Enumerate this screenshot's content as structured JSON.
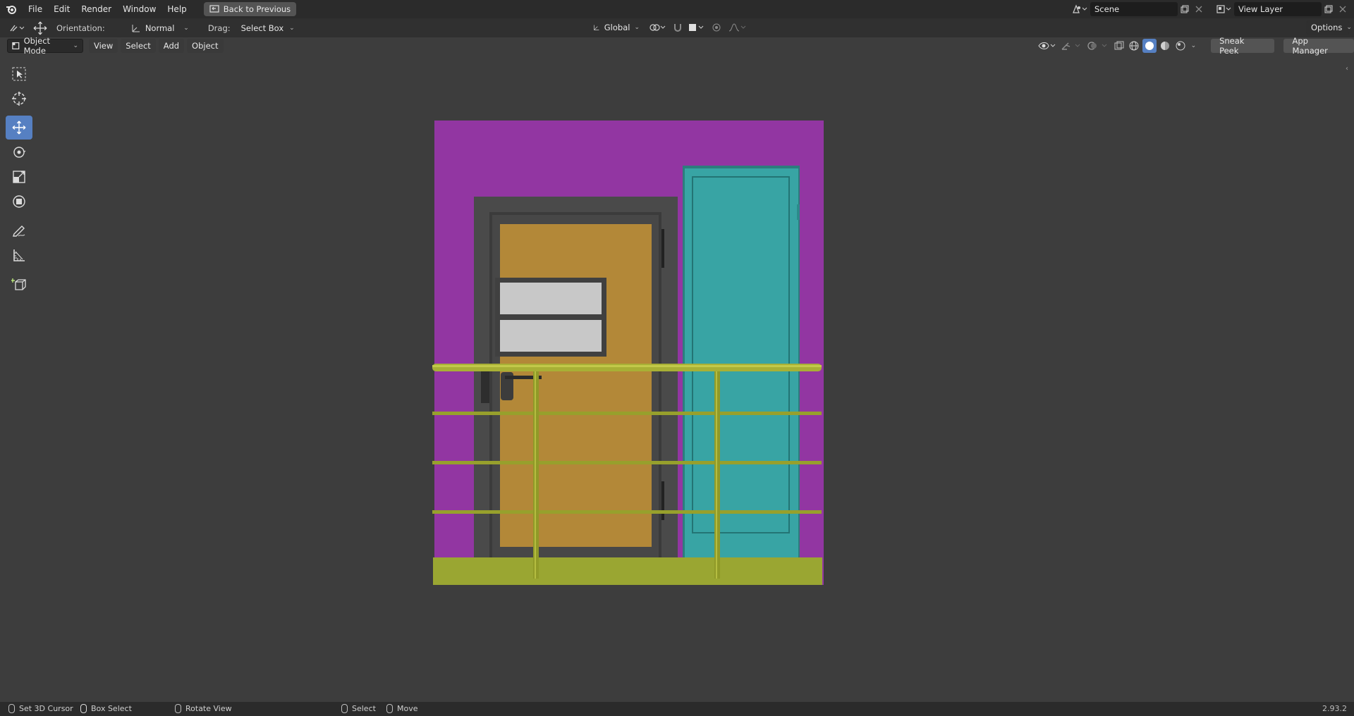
{
  "topbar": {
    "menus": [
      "File",
      "Edit",
      "Render",
      "Window",
      "Help"
    ],
    "back_label": "Back to Previous",
    "scene_name": "Scene",
    "view_layer": "View Layer"
  },
  "toolheader": {
    "orientation_label": "Orientation:",
    "orientation_value": "Normal",
    "drag_label": "Drag:",
    "drag_value": "Select Box",
    "transform_orientation": "Global",
    "options_label": "Options"
  },
  "viewport_header": {
    "mode": "Object Mode",
    "menus": [
      "View",
      "Select",
      "Add",
      "Object"
    ],
    "sneak_peek": "Sneak Peek",
    "app_manager": "App Manager"
  },
  "toolbar": {
    "tools": [
      "select-box-tool",
      "cursor-tool",
      "move-tool",
      "rotate-tool",
      "scale-tool",
      "transform-tool",
      "annotate-tool",
      "measure-tool",
      "add-cube-tool"
    ],
    "active": "move-tool"
  },
  "statusbar": {
    "items": [
      "Set 3D Cursor",
      "Box Select",
      "Rotate View",
      "Select",
      "Move"
    ],
    "version": "2.93.2"
  },
  "colors": {
    "wall": "#9236a2",
    "frame": "#4a4a4a",
    "door_wood": "#b38838",
    "door_teal": "#38a4a4",
    "railing": "#9aa632",
    "window": "#c8c8c8",
    "active_tool": "#5680c2"
  }
}
